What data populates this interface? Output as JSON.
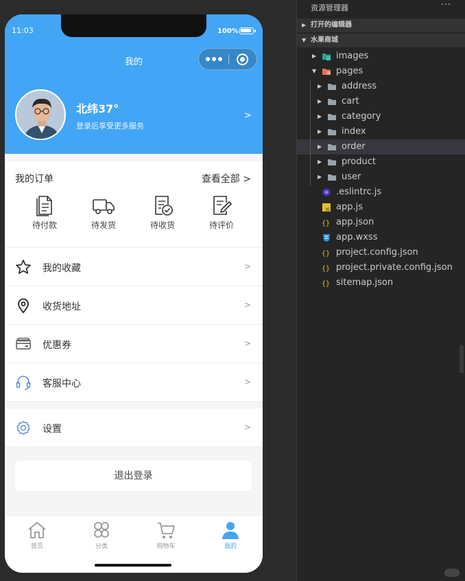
{
  "simulator": {
    "status": {
      "time": "11:03",
      "battery": "100%"
    },
    "nav_title": "我的",
    "user": {
      "name": "北纬37°",
      "subtitle": "登录后享受更多服务",
      "arrow": ">"
    },
    "orders": {
      "title": "我的订单",
      "view_all": "查看全部 >",
      "items": [
        {
          "label": "待付款",
          "icon": "document-icon"
        },
        {
          "label": "待发货",
          "icon": "truck-icon"
        },
        {
          "label": "待收货",
          "icon": "checklist-icon"
        },
        {
          "label": "待评价",
          "icon": "edit-document-icon"
        }
      ]
    },
    "menu": [
      {
        "label": "我的收藏",
        "icon": "star-icon",
        "arrow": ">"
      },
      {
        "label": "收货地址",
        "icon": "location-pin-icon",
        "arrow": ">"
      },
      {
        "label": "优惠券",
        "icon": "coupon-card-icon",
        "arrow": ">"
      },
      {
        "label": "客服中心",
        "icon": "headset-icon",
        "arrow": ">"
      }
    ],
    "settings": {
      "label": "设置",
      "icon": "gear-icon",
      "arrow": ">"
    },
    "logout": "退出登录",
    "tabs": [
      {
        "label": "首页",
        "icon": "home-icon",
        "active": false
      },
      {
        "label": "分类",
        "icon": "category-icon",
        "active": false
      },
      {
        "label": "购物车",
        "icon": "cart-icon",
        "active": false
      },
      {
        "label": "我的",
        "icon": "user-icon",
        "active": true
      }
    ],
    "colors": {
      "primary": "#42a5f5",
      "background": "#f5f5f5"
    }
  },
  "explorer": {
    "title": "资源管理器",
    "more": "···",
    "open_editors": "打开的编辑器",
    "project": "水果商城",
    "tree": [
      {
        "label": "images",
        "type": "folder",
        "level": 1,
        "expanded": false
      },
      {
        "label": "pages",
        "type": "folder",
        "level": 1,
        "expanded": true
      },
      {
        "label": "address",
        "type": "folder",
        "level": 2
      },
      {
        "label": "cart",
        "type": "folder",
        "level": 2
      },
      {
        "label": "category",
        "type": "folder",
        "level": 2
      },
      {
        "label": "index",
        "type": "folder",
        "level": 2
      },
      {
        "label": "order",
        "type": "folder",
        "level": 2,
        "selected": true
      },
      {
        "label": "product",
        "type": "folder",
        "level": 2
      },
      {
        "label": "user",
        "type": "folder",
        "level": 2
      },
      {
        "label": ".eslintrc.js",
        "type": "eslint",
        "level": 1
      },
      {
        "label": "app.js",
        "type": "js",
        "level": 1
      },
      {
        "label": "app.json",
        "type": "json",
        "level": 1
      },
      {
        "label": "app.wxss",
        "type": "css",
        "level": 1
      },
      {
        "label": "project.config.json",
        "type": "json",
        "level": 1
      },
      {
        "label": "project.private.config.json",
        "type": "json",
        "level": 1
      },
      {
        "label": "sitemap.json",
        "type": "json",
        "level": 1
      }
    ]
  }
}
